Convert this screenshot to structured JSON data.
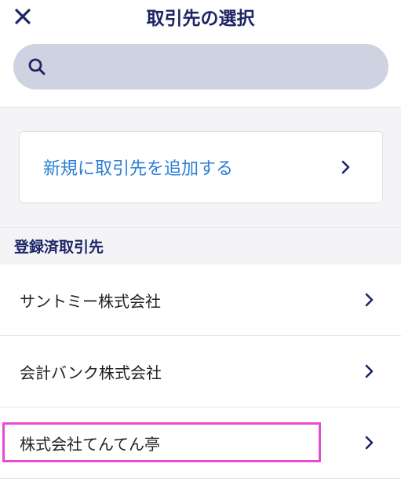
{
  "header": {
    "title": "取引先の選択",
    "close_icon": "close-icon"
  },
  "search": {
    "placeholder": "",
    "value": "",
    "icon": "search-icon"
  },
  "new_partner": {
    "label": "新規に取引先を追加する",
    "icon": "chevron-right-icon"
  },
  "section": {
    "title": "登録済取引先"
  },
  "partners": [
    {
      "name": "サントミー株式会社"
    },
    {
      "name": "会計バンク株式会社"
    },
    {
      "name": "株式会社てんてん亭"
    }
  ],
  "colors": {
    "navy": "#1d2566",
    "link_blue": "#2a7fd6",
    "search_bg": "#cfd2e0",
    "highlight": "#e64bd2"
  }
}
